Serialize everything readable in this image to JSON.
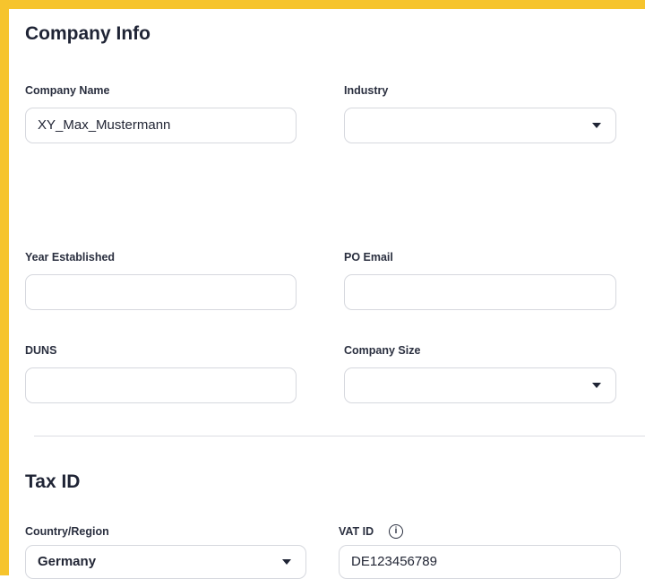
{
  "company_info": {
    "title": "Company Info",
    "company_name": {
      "label": "Company Name",
      "value": "XY_Max_Mustermann"
    },
    "industry": {
      "label": "Industry",
      "value": ""
    },
    "year_established": {
      "label": "Year Established",
      "value": ""
    },
    "po_email": {
      "label": "PO Email",
      "value": ""
    },
    "duns": {
      "label": "DUNS",
      "value": ""
    },
    "company_size": {
      "label": "Company Size",
      "value": ""
    }
  },
  "tax_id": {
    "title": "Tax ID",
    "country_region": {
      "label": "Country/Region",
      "value": "Germany"
    },
    "vat_id": {
      "label": "VAT ID",
      "value": "DE123456789"
    }
  },
  "colors": {
    "accent_border": "#f6c42d",
    "text": "#1f2435",
    "field_border": "#d6d8de"
  }
}
